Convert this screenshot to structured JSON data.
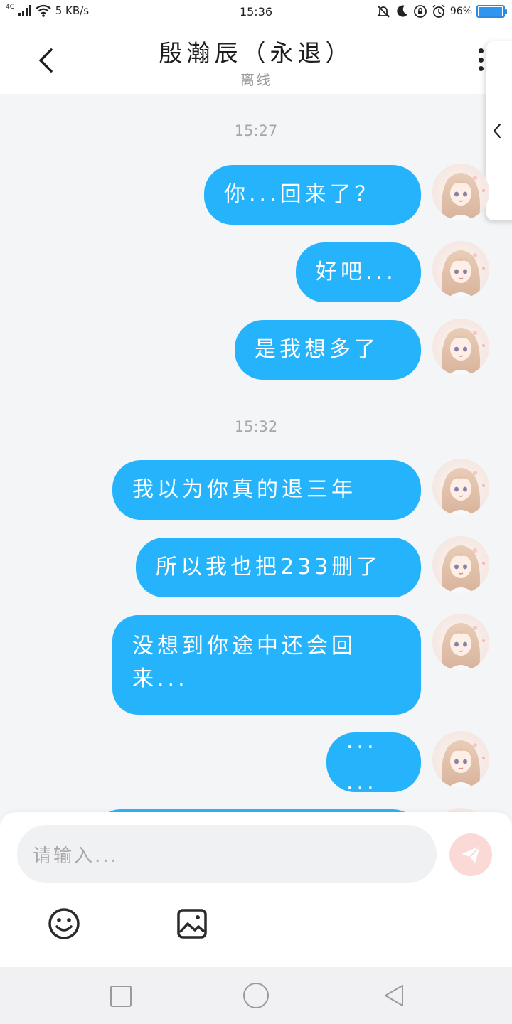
{
  "status_bar": {
    "network": "4G",
    "speed": "5 KB/s",
    "time": "15:36",
    "battery": "96%",
    "battery_level": 0.96
  },
  "header": {
    "title": "殷瀚辰（永退）",
    "status": "离线"
  },
  "timestamps": [
    "15:27",
    "15:32"
  ],
  "messages": [
    {
      "text": "你...回来了？"
    },
    {
      "text": "好吧..."
    },
    {
      "text": "是我想多了"
    },
    {
      "text": "我以为你真的退三年"
    },
    {
      "text": "所以我也把233删了"
    },
    {
      "line1": "没想到你途中还会回",
      "line2": "来..."
    },
    {
      "text": "... ..."
    }
  ],
  "composer": {
    "placeholder": "请输入..."
  },
  "icons": {
    "back": "chevron-left-icon",
    "more": "more-vertical-icon",
    "send": "paper-plane-icon",
    "emoji": "smiley-icon",
    "image": "image-icon",
    "drawer": "chevron-left-icon"
  },
  "colors": {
    "bubble": "#25b4fc",
    "send_button": "#fbd9d6",
    "battery": "#2f95f0"
  }
}
